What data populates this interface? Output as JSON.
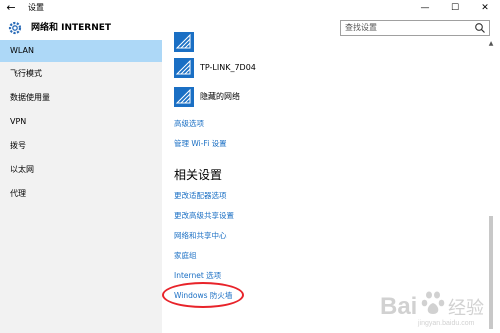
{
  "titlebar": {
    "back_glyph": "←",
    "title": "设置",
    "minimize_glyph": "—",
    "maximize_glyph": "☐",
    "close_glyph": "✕"
  },
  "header": {
    "icon": "gear-icon",
    "section_title": "网络和 INTERNET",
    "search_placeholder": "查找设置"
  },
  "sidebar": {
    "items": [
      {
        "label": "WLAN",
        "active": true
      },
      {
        "label": "飞行模式",
        "active": false
      },
      {
        "label": "数据使用量",
        "active": false
      },
      {
        "label": "VPN",
        "active": false
      },
      {
        "label": "拨号",
        "active": false
      },
      {
        "label": "以太网",
        "active": false
      },
      {
        "label": "代理",
        "active": false
      }
    ]
  },
  "content": {
    "networks": [
      {
        "name": "",
        "icon": "wifi-icon"
      },
      {
        "name": "TP-LINK_7D04",
        "icon": "wifi-icon"
      },
      {
        "name": "隐藏的网络",
        "icon": "wifi-icon"
      }
    ],
    "advanced_options": "高级选项",
    "manage_wifi": "管理 Wi-Fi 设置",
    "related_heading": "相关设置",
    "related_links": [
      "更改适配器选项",
      "更改高级共享设置",
      "网络和共享中心",
      "家庭组",
      "Internet 选项",
      "Windows 防火墙"
    ]
  },
  "colors": {
    "accent": "#1a6fc4",
    "sidebar_bg": "#f2f2f2",
    "active_bg": "#add8f7",
    "highlight": "#e8232a"
  },
  "watermark": {
    "text": "Bai 经验",
    "subtext": "jingyan.baidu.com"
  }
}
